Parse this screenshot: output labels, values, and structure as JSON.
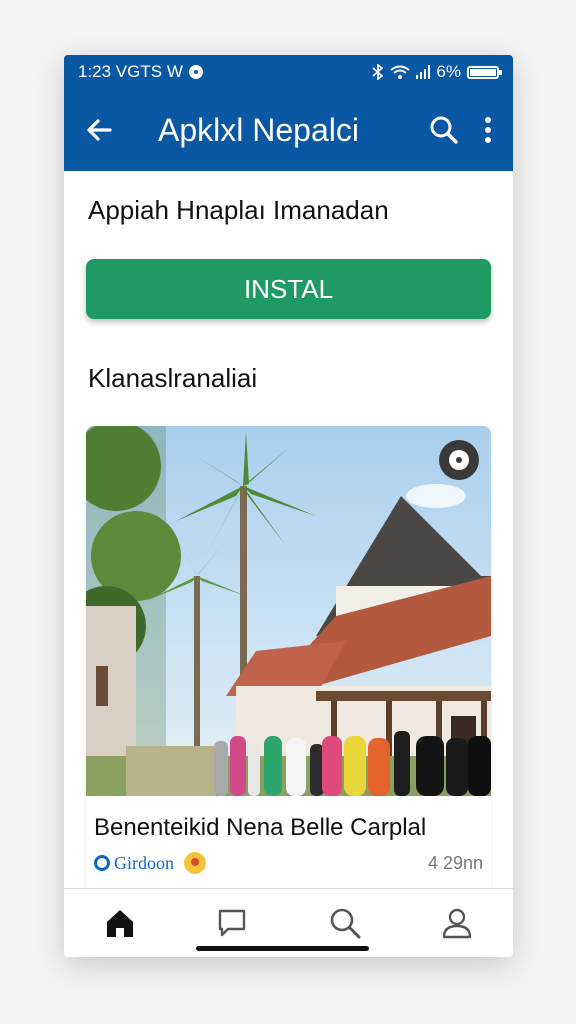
{
  "status": {
    "time": "1:23 VGTS W",
    "battery": "6%",
    "battery_level": 0.9
  },
  "appbar": {
    "title": "Apklxl Nepalci",
    "back_icon": "arrow-left-icon",
    "search_icon": "search-icon",
    "menu_icon": "more-vert-icon"
  },
  "page": {
    "heading": "Appiah Hnaplaı Imanadan",
    "install_label": "INSTAL",
    "install_color": "#1f9a63",
    "section_title": "Klanaslranaliai"
  },
  "card": {
    "title": "Benenteikid Nena Belle Carplal",
    "source": "Girdoon",
    "time": "4 29nn"
  },
  "nav": {
    "items": [
      "home-icon",
      "chat-icon",
      "search-icon",
      "profile-icon"
    ]
  },
  "colors": {
    "primary": "#0a57a3",
    "accent": "#1f9a63"
  }
}
